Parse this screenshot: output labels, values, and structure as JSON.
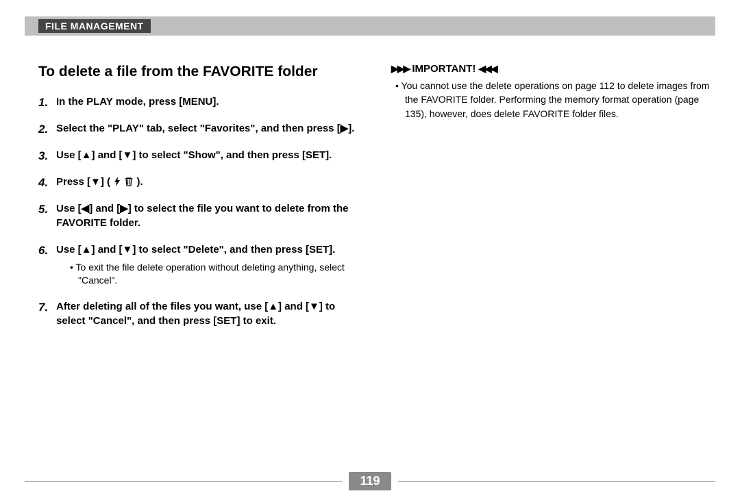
{
  "header": {
    "section": "FILE MANAGEMENT"
  },
  "left": {
    "title": "To delete a file from the FAVORITE folder",
    "steps": [
      {
        "text": "In the PLAY mode, press [MENU]."
      },
      {
        "text": "Select the \"PLAY\" tab, select \"Favorites\", and then press [▶]."
      },
      {
        "text": "Use [▲] and [▼] to select \"Show\", and then press [SET]."
      },
      {
        "text": "Press [▼] ( 🗲 🗑 )."
      },
      {
        "text": "Use [◀] and [▶] to select the file you want to delete from the FAVORITE folder."
      },
      {
        "text": "Use [▲] and [▼] to select \"Delete\", and then press [SET].",
        "sub": "To exit the file delete operation without deleting anything, select \"Cancel\"."
      },
      {
        "text": "After deleting all of the files you want, use [▲] and [▼] to select \"Cancel\", and then press [SET] to exit."
      }
    ]
  },
  "right": {
    "important_label": "IMPORTANT!",
    "important_text": "You cannot use the delete operations on page 112 to delete images from the FAVORITE folder. Performing the memory format operation (page 135), however, does delete FAVORITE folder files."
  },
  "page_number": "119"
}
